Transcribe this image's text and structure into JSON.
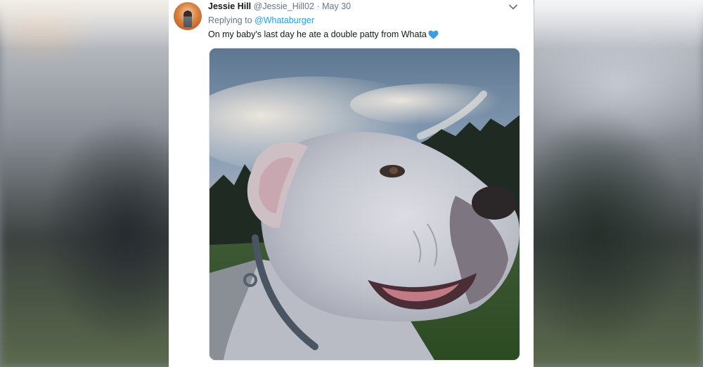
{
  "tweet": {
    "author_name": "Jessie Hill",
    "author_handle": "@Jessie_Hill02",
    "separator": "·",
    "date": "May 30",
    "replying_prefix": "Replying to",
    "replying_handle": "@Whataburger",
    "text": "On my baby's last day he ate a double patty from Whata",
    "emoji": "blue-heart-icon",
    "menu_icon": "chevron-down-icon",
    "photo_subject": "dog-photo"
  },
  "colors": {
    "link": "#1da1f2",
    "secondary_text": "#657786",
    "primary_text": "#14171a",
    "heart": "#3b9de8"
  }
}
